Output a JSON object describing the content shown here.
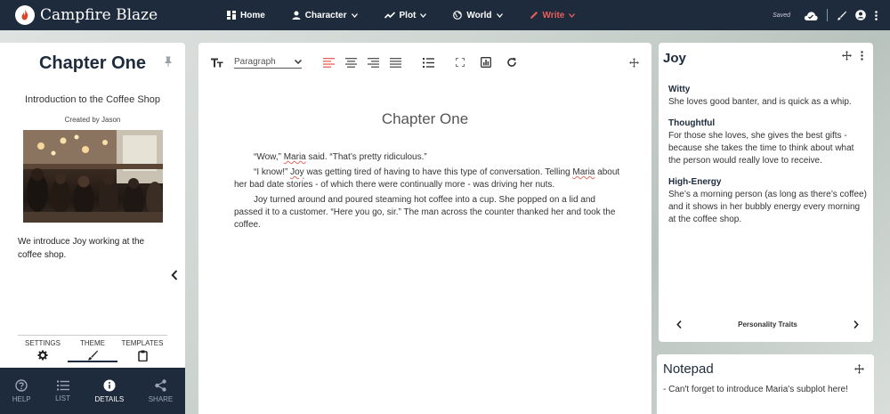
{
  "app": {
    "title": "Campfire Blaze"
  },
  "nav": {
    "home": "Home",
    "character": "Character",
    "plot": "Plot",
    "world": "World",
    "write": "Write"
  },
  "status": {
    "saved": "Saved"
  },
  "colors": {
    "navy": "#1e2b3c",
    "accent_red": "#e8605a"
  },
  "chapter": {
    "title": "Chapter One",
    "subtitle": "Introduction to the Coffee Shop",
    "created_by": "Created by Jason",
    "summary": "We introduce Joy working at the coffee shop."
  },
  "settings_tabs": [
    "SETTINGS",
    "THEME",
    "TEMPLATES"
  ],
  "bottom_tabs": [
    "HELP",
    "LIST",
    "DETAILS",
    "SHARE"
  ],
  "toolbar": {
    "paragraph_style": "Paragraph"
  },
  "document": {
    "title": "Chapter One",
    "p1": {
      "a": "“Wow,” ",
      "b": "Maria",
      "c": " said. “That’s pretty ridiculous.”"
    },
    "p2": {
      "a": "“I know!” ",
      "b": "Joy",
      "c": " was getting tired of having to have this type of conversation. Telling ",
      "d": "Maria",
      "e": " about her bad date stories - of which there were continually more - was driving her nuts."
    },
    "p3": "Joy turned around and poured steaming hot coffee into a cup. She popped on a lid and passed it to a customer. “Here you go, sir.” The man across the counter thanked her and took the coffee."
  },
  "character": {
    "name": "Joy",
    "traits": [
      {
        "name": "Witty",
        "desc": "She loves good banter, and is quick as a whip."
      },
      {
        "name": "Thoughtful",
        "desc": "For those she loves, she gives the best gifts - because she takes the time to think about what the person would really love to receive."
      },
      {
        "name": "High-Energy",
        "desc": "She’s a morning person (as long as there’s coffee) and it shows in her bubbly energy every morning at the coffee shop."
      }
    ],
    "section_label": "Personality Traits"
  },
  "notepad": {
    "title": "Notepad",
    "text": "- Can't forget to introduce Maria's subplot here!"
  }
}
